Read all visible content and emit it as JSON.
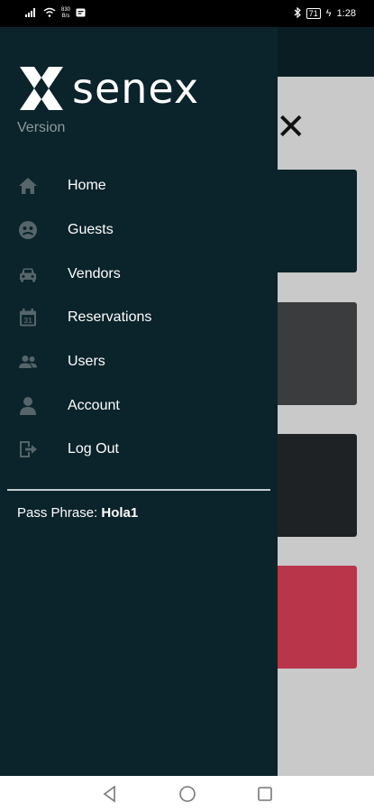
{
  "status_bar": {
    "net_speed_value": "830",
    "net_speed_unit": "B/s",
    "battery": "71",
    "time": "1:28"
  },
  "drawer": {
    "brand_name": "senex",
    "version_label": "Version",
    "menu": [
      {
        "label": "Home",
        "icon": "home-icon"
      },
      {
        "label": "Guests",
        "icon": "guests-icon"
      },
      {
        "label": "Vendors",
        "icon": "car-icon"
      },
      {
        "label": "Reservations",
        "icon": "calendar-icon"
      },
      {
        "label": "Users",
        "icon": "users-icon"
      },
      {
        "label": "Account",
        "icon": "account-icon"
      },
      {
        "label": "Log Out",
        "icon": "logout-icon"
      }
    ],
    "calendar_day": "31",
    "pass_phrase_label": "Pass Phrase: ",
    "pass_phrase_value": "Hola1"
  },
  "colors": {
    "drawer_bg": "#0b232a",
    "icon": "#55656a",
    "accent_card": "#b8354a"
  }
}
